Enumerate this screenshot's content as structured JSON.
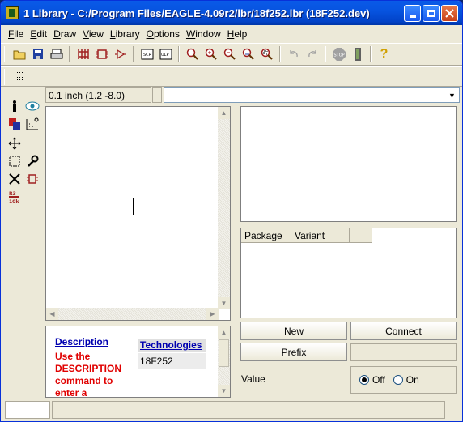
{
  "window": {
    "title": "1 Library - C:/Program Files/EAGLE-4.09r2/lbr/18f252.lbr (18F252.dev)"
  },
  "menubar": {
    "items": [
      {
        "label_u": "F",
        "label_rest": "ile"
      },
      {
        "label_u": "E",
        "label_rest": "dit"
      },
      {
        "label_u": "D",
        "label_rest": "raw"
      },
      {
        "label_u": "V",
        "label_rest": "iew"
      },
      {
        "label_u": "L",
        "label_rest": "ibrary"
      },
      {
        "label_u": "O",
        "label_rest": "ptions"
      },
      {
        "label_u": "W",
        "label_rest": "indow"
      },
      {
        "label_u": "H",
        "label_rest": "elp"
      }
    ]
  },
  "parambar": {
    "coordinate": "0.1 inch (1.2 -8.0)"
  },
  "description": {
    "link": "Description",
    "text": "Use the DESCRIPTION command to enter a",
    "technologies_link": "Technologies",
    "technology_value": "18F252"
  },
  "variants": {
    "columns": [
      "Package",
      "Variant"
    ]
  },
  "buttons": {
    "new": "New",
    "connect": "Connect",
    "prefix": "Prefix"
  },
  "value": {
    "label": "Value",
    "options": [
      "Off",
      "On"
    ],
    "selected": "Off"
  },
  "colors": {
    "title_gradient_top": "#0a5ae8",
    "description_text": "#e00000",
    "link": "#0000b0"
  }
}
